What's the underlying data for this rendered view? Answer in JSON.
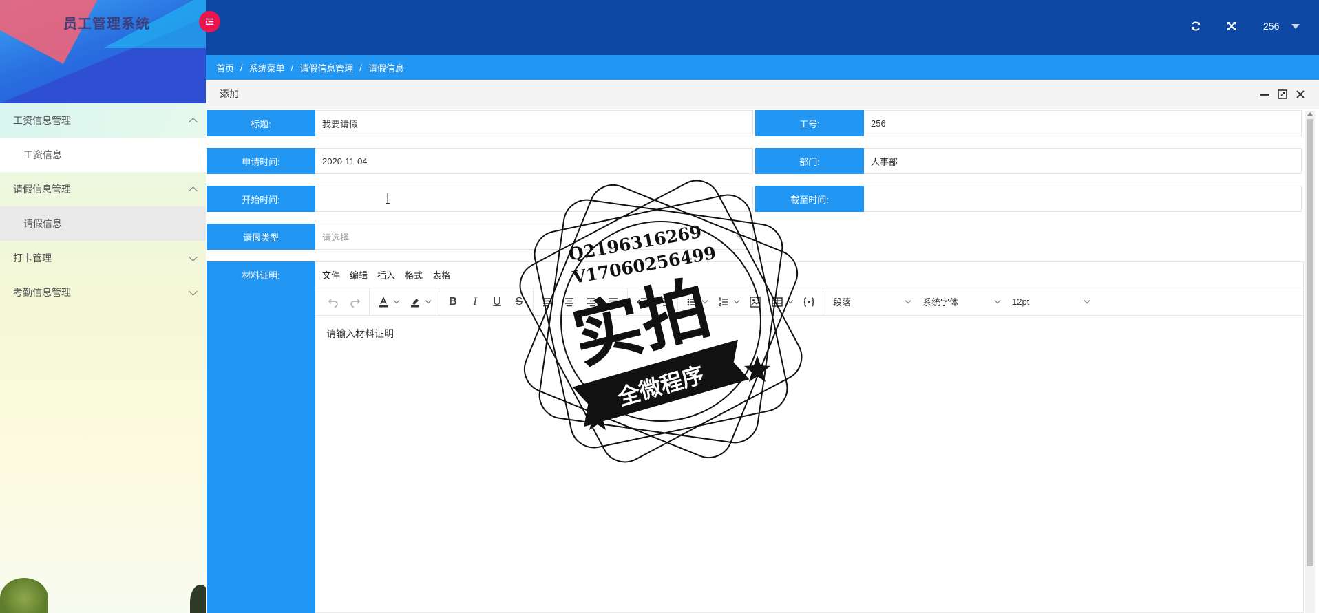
{
  "app": {
    "title": "员工管理系统"
  },
  "sidebar": {
    "groups": [
      {
        "label": "工资信息管理",
        "expanded": true,
        "items": [
          {
            "label": "工资信息",
            "selected": false
          }
        ]
      },
      {
        "label": "请假信息管理",
        "expanded": true,
        "items": [
          {
            "label": "请假信息",
            "selected": true
          }
        ]
      },
      {
        "label": "打卡管理",
        "expanded": false,
        "items": []
      },
      {
        "label": "考勤信息管理",
        "expanded": false,
        "items": []
      }
    ]
  },
  "header": {
    "user": "256",
    "icons": [
      "refresh-icon",
      "fullscreen-icon"
    ]
  },
  "breadcrumb": {
    "items": [
      "首页",
      "系统菜单",
      "请假信息管理",
      "请假信息"
    ],
    "separator": "/"
  },
  "dialog": {
    "title": "添加",
    "form": {
      "title_label": "标题:",
      "title_value": "我要请假",
      "empno_label": "工号:",
      "empno_value": "256",
      "apply_time_label": "申请时间:",
      "apply_time_value": "2020-11-04",
      "dept_label": "部门:",
      "dept_value": "人事部",
      "start_label": "开始时间:",
      "start_value": "",
      "end_label": "截至时间:",
      "end_value": "",
      "type_label": "请假类型",
      "type_placeholder": "请选择",
      "material_label": "材料证明:"
    },
    "editor": {
      "menus": [
        "文件",
        "编辑",
        "插入",
        "格式",
        "表格"
      ],
      "block_format": "段落",
      "font_family": "系统字体",
      "font_size": "12pt",
      "placeholder_text": "请输入材料证明"
    }
  },
  "watermark": {
    "line1": "Q2196316269",
    "line2": "V17060256499",
    "main": "实拍",
    "banner": "全微程序"
  },
  "colors": {
    "header_bg": "#0c47a4",
    "accent_blue": "#2196f3",
    "toggle_pink": "#e8154e"
  }
}
